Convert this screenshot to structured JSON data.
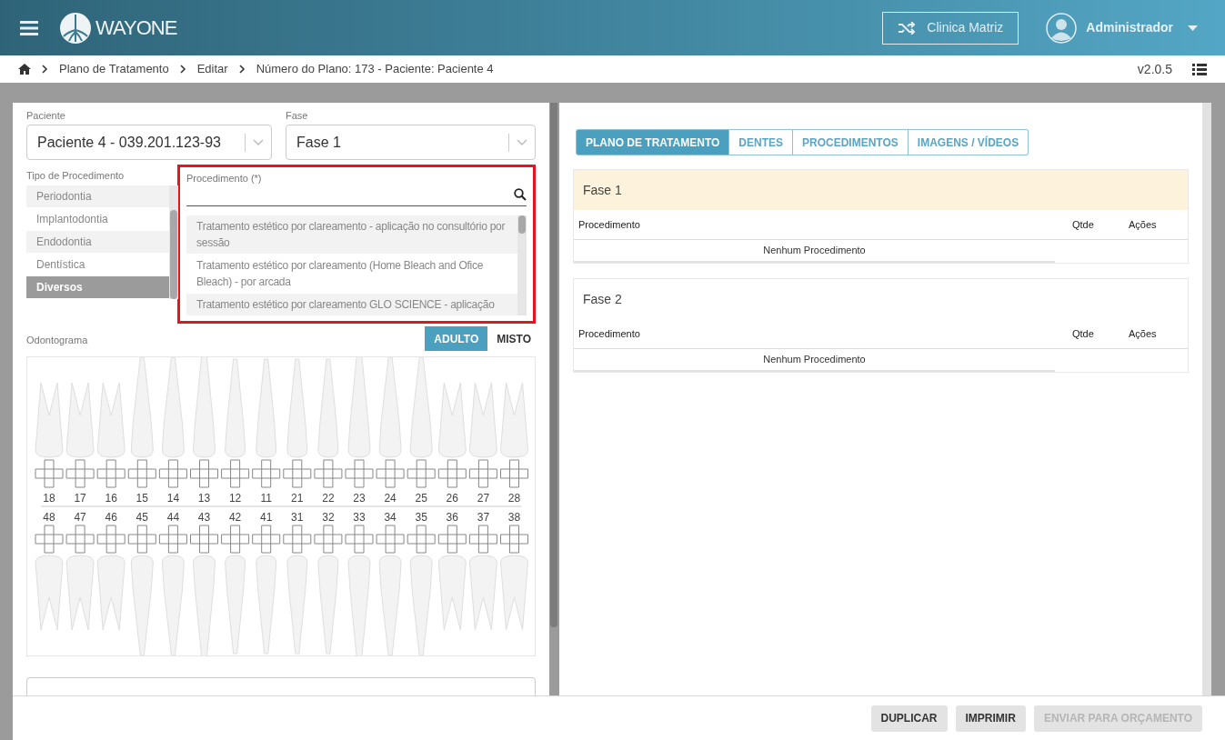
{
  "header": {
    "logo": "**WAY**ONE",
    "clinic_button": "Clinica Matriz",
    "user": "Administrador"
  },
  "breadcrumb": [
    "Plano de Tratamento",
    "Editar",
    "Número do Plano: 173 - Paciente: Paciente 4"
  ],
  "version": "v2.0.5",
  "form": {
    "patient": {
      "label": "Paciente",
      "value": "Paciente 4 - 039.201.123-93"
    },
    "phase": {
      "label": "Fase",
      "value": "Fase 1"
    },
    "procedure_type": {
      "label": "Tipo de Procedimento",
      "items": [
        {
          "label": "Periodontia",
          "selected": false
        },
        {
          "label": "Implantodontia",
          "selected": false
        },
        {
          "label": "Endodontia",
          "selected": false
        },
        {
          "label": "Dentística",
          "selected": false
        },
        {
          "label": "Diversos",
          "selected": true
        }
      ]
    },
    "procedure": {
      "label": "Procedimento (*)",
      "results": [
        "Tratamento estético por clareamento - aplicação no consultório por sessão",
        "Tratamento estético por clareamento (Home Bleach and Ofice Bleach) - por arcada",
        "Tratamento estético por clareamento GLO SCIENCE - aplicação"
      ]
    }
  },
  "odontogram": {
    "label": "Odontograma",
    "modes": [
      {
        "label": "ADULTO",
        "selected": true
      },
      {
        "label": "MISTO",
        "selected": false
      }
    ],
    "upper": [
      "18",
      "17",
      "16",
      "15",
      "14",
      "13",
      "12",
      "11",
      "21",
      "22",
      "23",
      "24",
      "25",
      "26",
      "27",
      "28"
    ],
    "lower": [
      "48",
      "47",
      "46",
      "45",
      "44",
      "43",
      "42",
      "41",
      "31",
      "32",
      "33",
      "34",
      "35",
      "36",
      "37",
      "38"
    ]
  },
  "tabs": [
    {
      "label": "PLANO DE TRATAMENTO",
      "selected": true
    },
    {
      "label": "DENTES",
      "selected": false
    },
    {
      "label": "PROCEDIMENTOS",
      "selected": false
    },
    {
      "label": "IMAGENS / VÍDEOS",
      "selected": false
    }
  ],
  "phases": [
    {
      "title": "Fase 1",
      "highlighted": true,
      "columns": [
        "Procedimento",
        "Qtde",
        "Ações"
      ],
      "empty": "Nenhum Procedimento"
    },
    {
      "title": "Fase 2",
      "highlighted": false,
      "columns": [
        "Procedimento",
        "Qtde",
        "Ações"
      ],
      "empty": "Nenhum Procedimento"
    }
  ],
  "footer_buttons": [
    {
      "label": "DUPLICAR",
      "disabled": false
    },
    {
      "label": "IMPRIMIR",
      "disabled": false
    },
    {
      "label": "ENVIAR PARA ORÇAMENTO",
      "disabled": true
    }
  ]
}
